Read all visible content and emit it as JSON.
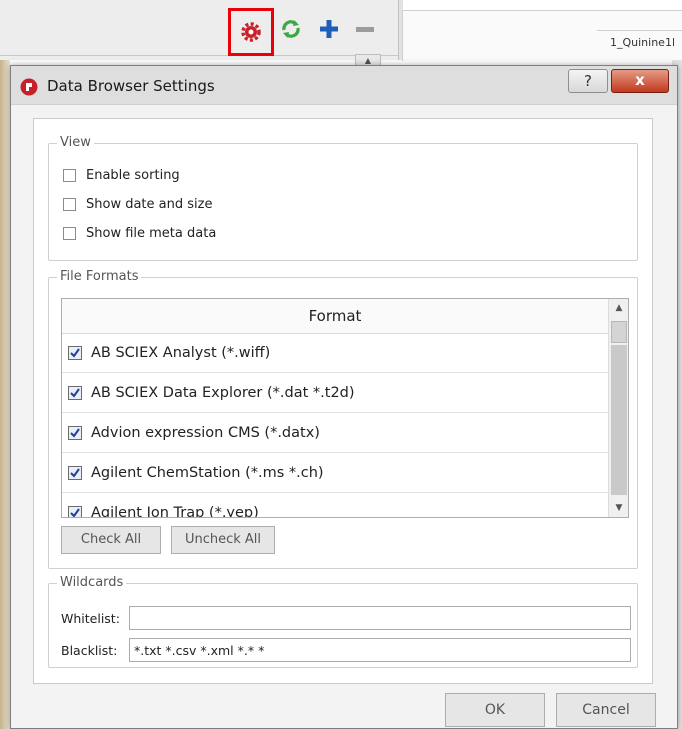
{
  "toolbar": {
    "settings_icon": "gear-icon",
    "refresh_icon": "refresh-icon",
    "add_icon": "plus-icon",
    "remove_icon": "minus-icon",
    "highlight_color": "#e8000b"
  },
  "background": {
    "column_label": "1_Quinine1l"
  },
  "dialog": {
    "title": "Data Browser Settings",
    "help_label": "?",
    "close_label": "x",
    "view": {
      "title": "View",
      "options": [
        {
          "label": "Enable sorting",
          "checked": false
        },
        {
          "label": "Show date and size",
          "checked": false
        },
        {
          "label": "Show file meta data",
          "checked": false
        }
      ]
    },
    "file_formats": {
      "title": "File Formats",
      "column_header": "Format",
      "rows": [
        {
          "label": "AB SCIEX Analyst (*.wiff)",
          "checked": true
        },
        {
          "label": "AB SCIEX Data Explorer (*.dat *.t2d)",
          "checked": true
        },
        {
          "label": "Advion expression CMS (*.datx)",
          "checked": true
        },
        {
          "label": "Agilent ChemStation (*.ms *.ch)",
          "checked": true
        },
        {
          "label": "Agilent Ion Trap (*.yep)",
          "checked": true
        }
      ],
      "check_all_label": "Check All",
      "uncheck_all_label": "Uncheck All"
    },
    "wildcards": {
      "title": "Wildcards",
      "whitelist_label": "Whitelist:",
      "whitelist_value": "",
      "blacklist_label": "Blacklist:",
      "blacklist_value": "*.txt *.csv *.xml *.* *"
    },
    "ok_label": "OK",
    "cancel_label": "Cancel"
  }
}
